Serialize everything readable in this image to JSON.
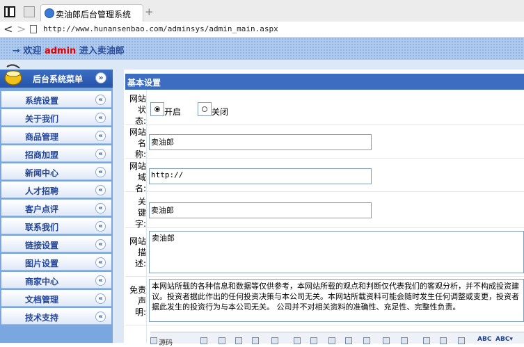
{
  "browser": {
    "tab_title": "卖油郎后台管理系统",
    "new_tab": "+",
    "url": "http://www.hunansenbao.com/adminsys/admin_main.aspx"
  },
  "header": {
    "welcome_prefix": "→ 欢迎",
    "username": "admin",
    "welcome_suffix": "进入卖油郎"
  },
  "sidebar": {
    "title": "后台系统菜单",
    "collapse_glyph": "»",
    "items": [
      {
        "label": "系统设置"
      },
      {
        "label": "关于我们"
      },
      {
        "label": "商品管理"
      },
      {
        "label": "招商加盟"
      },
      {
        "label": "新闻中心"
      },
      {
        "label": "人才招聘"
      },
      {
        "label": "客户点评"
      },
      {
        "label": "联系我们"
      },
      {
        "label": "链接设置"
      },
      {
        "label": "图片设置"
      },
      {
        "label": "商家中心"
      },
      {
        "label": "文档管理"
      },
      {
        "label": "技术支持"
      }
    ],
    "item_arrow": "«"
  },
  "panel": {
    "title": "基本设置",
    "site_status": {
      "label": "网站\n状\n态:",
      "options": [
        {
          "label": "开启",
          "checked": true
        },
        {
          "label": "关闭",
          "checked": false
        }
      ]
    },
    "site_name": {
      "label": "网站\n名\n称:",
      "value": "卖油郎"
    },
    "site_domain": {
      "label": "网站\n域\n名:",
      "value": "http://"
    },
    "keywords": {
      "label": "关\n键\n字:",
      "value": "卖油郎"
    },
    "description": {
      "label": "网站\n描\n述:",
      "value": "卖油郎"
    },
    "disclaimer": {
      "label": "免责\n声\n明:",
      "value": "本网站所载的各种信息和数据等仅供参考，本网站所载的观点和判断仅代表我们的客观分析，并不构成投资建议。投资者据此作出的任何投资决策与本公司无关。本网站所载资料可能会随时发生任何调整或变更，投资者据此发生的投资行为与本公司无关。 公司并不对相关资料的准确性、充足性、完整性负责。"
    },
    "toolbar": {
      "source_label": "源码"
    }
  }
}
